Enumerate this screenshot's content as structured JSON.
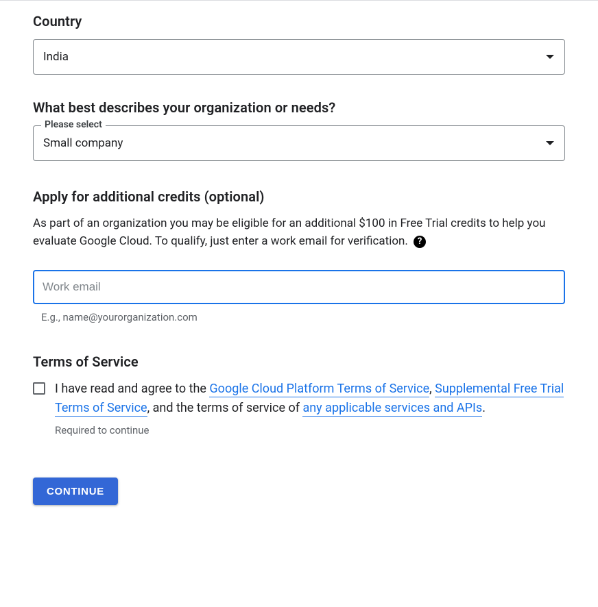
{
  "country": {
    "label": "Country",
    "value": "India"
  },
  "organization": {
    "label": "What best describes your organization or needs?",
    "floating_label": "Please select",
    "value": "Small company"
  },
  "credits": {
    "heading": "Apply for additional credits (optional)",
    "description": "As part of an organization you may be eligible for an additional $100 in Free Trial credits to help you evaluate Google Cloud. To qualify, just enter a work email for verification.",
    "email_placeholder": "Work email",
    "email_hint": "E.g., name@yourorganization.com"
  },
  "tos": {
    "heading": "Terms of Service",
    "prefix": "I have read and agree to the ",
    "link1": "Google Cloud Platform Terms of Service",
    "sep1": ", ",
    "link2": "Supplemental Free Trial Terms of Service",
    "sep2": ", and the terms of service of ",
    "link3": "any applicable services and APIs",
    "suffix": ".",
    "required_note": "Required to continue"
  },
  "continue_label": "CONTINUE"
}
